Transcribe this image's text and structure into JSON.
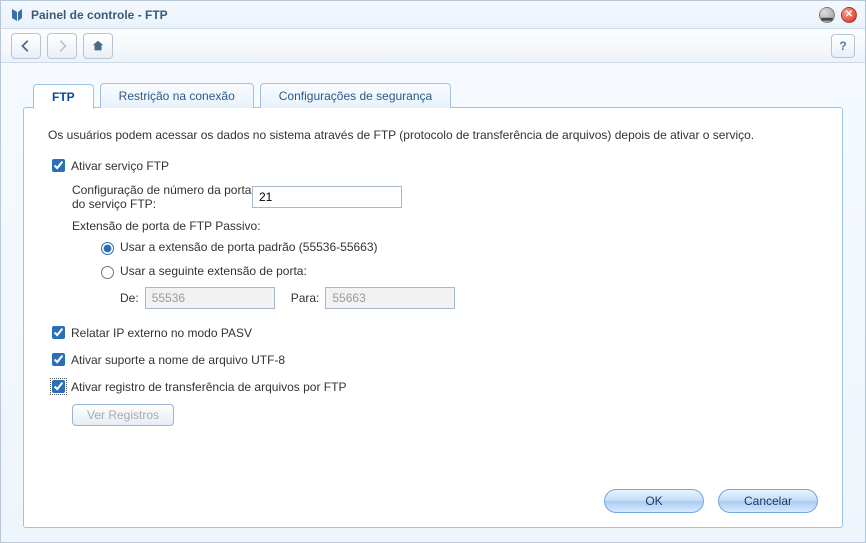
{
  "window": {
    "title": "Painel de controle - FTP"
  },
  "tabs": {
    "ftp": "FTP",
    "restriction": "Restrição na conexão",
    "security": "Configurações de segurança"
  },
  "desc": "Os usuários podem acessar os dados no sistema através de FTP (protocolo de transferência de arquivos) depois de ativar o serviço.",
  "enable_service": "Ativar serviço FTP",
  "port_label": "Configuração de número da porta do serviço FTP:",
  "port_value": "21",
  "passive_label": "Extensão de porta de FTP Passivo:",
  "radio_default": "Usar a extensão de porta padrão (55536-55663)",
  "radio_custom": "Usar a seguinte extensão de porta:",
  "range_from_label": "De:",
  "range_from_value": "55536",
  "range_to_label": "Para:",
  "range_to_value": "55663",
  "chk_pasv": "Relatar IP externo no modo PASV",
  "chk_utf8": "Ativar suporte a nome de arquivo UTF-8",
  "chk_log": "Ativar registro de transferência de arquivos por FTP",
  "btn_viewlog": "Ver Registros",
  "btn_ok": "OK",
  "btn_cancel": "Cancelar"
}
